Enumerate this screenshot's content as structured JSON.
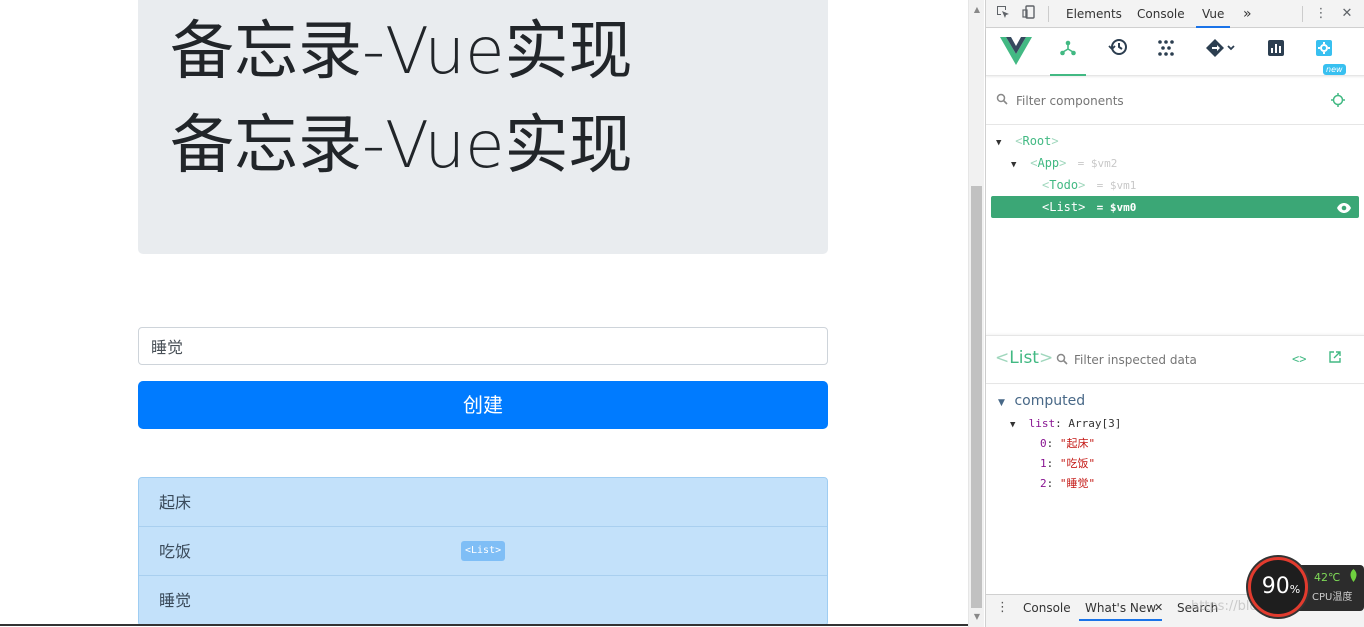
{
  "page": {
    "title_line1": "备忘录-Vue实现",
    "title_line2": "备忘录-Vue实现",
    "input_value": "睡觉",
    "create_button": "创建",
    "list_items": [
      "起床",
      "吃饭",
      "睡觉"
    ],
    "list_tag": "<List>"
  },
  "devtools": {
    "tabs": [
      "Elements",
      "Console",
      "Vue"
    ],
    "active_tab": "Vue",
    "more_tabs": "»",
    "filter_components_placeholder": "Filter components",
    "tree": [
      {
        "tag": "Root",
        "ref": ""
      },
      {
        "tag": "App",
        "ref": "= $vm2"
      },
      {
        "tag": "Todo",
        "ref": "= $vm1"
      },
      {
        "tag": "List",
        "ref": "= $vm0"
      }
    ],
    "inspector": {
      "component": "List",
      "filter_placeholder": "Filter inspected data",
      "section": "computed",
      "prop_key": "list",
      "prop_type": "Array[3]",
      "items": [
        {
          "index": "0",
          "value": "\"起床\""
        },
        {
          "index": "1",
          "value": "\"吃饭\""
        },
        {
          "index": "2",
          "value": "\"睡觉\""
        }
      ]
    },
    "new_badge": "new",
    "drawer_tabs": [
      "Console",
      "What's New",
      "Search"
    ],
    "watermark": "https://blog.csdn.net/weixin_44364444"
  },
  "cpu": {
    "percent": "90",
    "percent_sign": "%",
    "temp": "42℃",
    "label": "CPU温度"
  },
  "colors": {
    "primary": "#007bff",
    "vue_green": "#42b983",
    "selected_row": "#3ba776",
    "list_bg": "#c8e3fa"
  }
}
